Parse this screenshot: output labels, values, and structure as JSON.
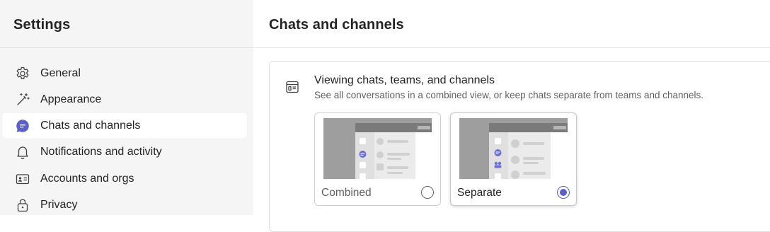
{
  "sidebar": {
    "title": "Settings",
    "items": [
      {
        "label": "General",
        "icon": "gear-icon"
      },
      {
        "label": "Appearance",
        "icon": "magic-wand-icon"
      },
      {
        "label": "Chats and channels",
        "icon": "chat-bubble-icon",
        "selected": true
      },
      {
        "label": "Notifications and activity",
        "icon": "bell-icon"
      },
      {
        "label": "Accounts and orgs",
        "icon": "id-card-icon"
      },
      {
        "label": "Privacy",
        "icon": "lock-icon"
      }
    ]
  },
  "main": {
    "title": "Chats and channels",
    "section": {
      "icon": "layout-view-icon",
      "title": "Viewing chats, teams, and channels",
      "description": "See all conversations in a combined view, or keep chats separate from teams and channels.",
      "options": [
        {
          "label": "Combined",
          "selected": false
        },
        {
          "label": "Separate",
          "selected": true
        }
      ]
    }
  },
  "colors": {
    "accent": "#5b5fc7",
    "sidebar_bg": "#f5f5f5",
    "text": "#242424",
    "secondary_text": "#616161"
  }
}
